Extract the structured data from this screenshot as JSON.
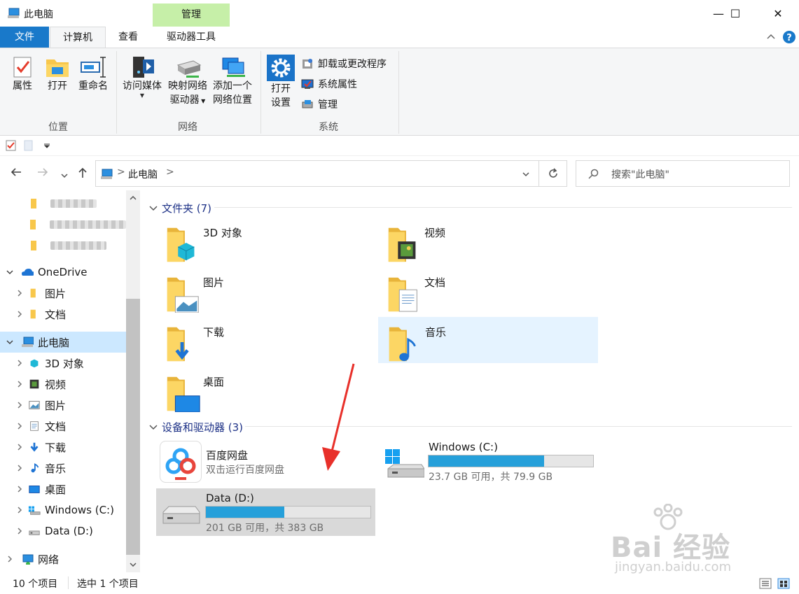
{
  "window": {
    "title": "此电脑",
    "minimize_glyph": "—",
    "maximize_glyph": "☐",
    "close_glyph": "✕"
  },
  "ribbon_tabs": {
    "file": "文件",
    "computer": "计算机",
    "view": "查看",
    "context_header": "管理",
    "drive_tools": "驱动器工具"
  },
  "ribbon": {
    "location_group": {
      "label": "位置",
      "properties": "属性",
      "open": "打开",
      "rename": "重命名"
    },
    "network_group": {
      "label": "网络",
      "access_media": "访问媒体",
      "map_drive_line1": "映射网络",
      "map_drive_line2": "驱动器",
      "add_location_line1": "添加一个",
      "add_location_line2": "网络位置"
    },
    "system_group": {
      "label": "系统",
      "open_settings_line1": "打开",
      "open_settings_line2": "设置",
      "uninstall": "卸载或更改程序",
      "system_properties": "系统属性",
      "manage": "管理"
    }
  },
  "address_bar": {
    "path": "此电脑",
    "separator": ">",
    "search_placeholder": "搜索\"此电脑\""
  },
  "nav_pane": {
    "onedrive": "OneDrive",
    "onedrive_children": [
      "图片",
      "文档"
    ],
    "this_pc": "此电脑",
    "this_pc_children": [
      "3D 对象",
      "视频",
      "图片",
      "文档",
      "下载",
      "音乐",
      "桌面",
      "Windows (C:)",
      "Data (D:)"
    ],
    "network": "网络"
  },
  "content": {
    "folders_header": "文件夹 (7)",
    "folders": [
      "3D 对象",
      "视频",
      "图片",
      "文档",
      "下载",
      "音乐",
      "桌面"
    ],
    "devices_header": "设备和驱动器 (3)",
    "baidu": {
      "name": "百度网盘",
      "subtitle": "双击运行百度网盘"
    },
    "drive_c": {
      "name": "Windows (C:)",
      "space": "23.7 GB 可用，共 79.9 GB",
      "used_fraction": 0.7
    },
    "drive_d": {
      "name": "Data (D:)",
      "space": "201 GB 可用，共 383 GB",
      "used_fraction": 0.475
    }
  },
  "status_bar": {
    "item_count": "10 个项目",
    "selected": "选中 1 个项目"
  },
  "watermark": {
    "brand": "Bai 经验",
    "url": "jingyan.baidu.com"
  },
  "colors": {
    "accent": "#1979ca",
    "selection": "#cce8ff",
    "drive_bar": "#26a0da",
    "context_tab": "#c6efa8",
    "annotation_arrow": "#e8302a"
  }
}
